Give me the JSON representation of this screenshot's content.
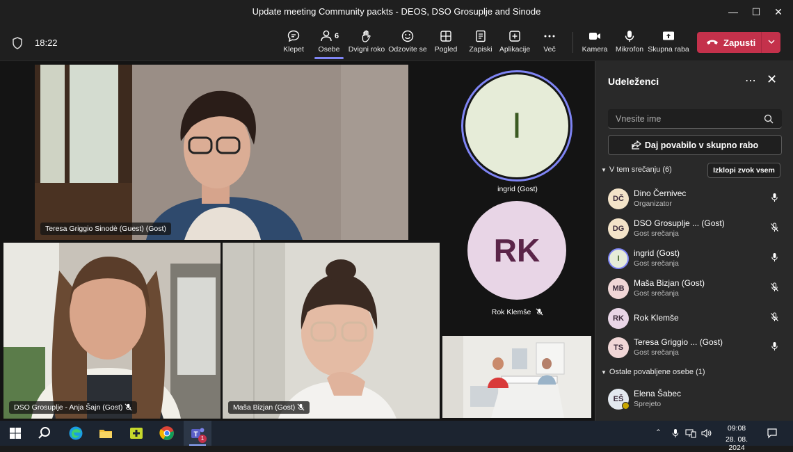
{
  "window": {
    "title": "Update meeting Community packts - DEOS, DSO Grosuplje and Sinode"
  },
  "toolbar": {
    "time": "18:22",
    "buttons": [
      {
        "id": "chat",
        "label": "Klepet"
      },
      {
        "id": "people",
        "label": "Osebe",
        "badge": "6"
      },
      {
        "id": "raise",
        "label": "Dvigni roko"
      },
      {
        "id": "react",
        "label": "Odzovite se"
      },
      {
        "id": "view",
        "label": "Pogled"
      },
      {
        "id": "notes",
        "label": "Zapiski"
      },
      {
        "id": "apps",
        "label": "Aplikacije"
      },
      {
        "id": "more",
        "label": "Več"
      },
      {
        "id": "camera",
        "label": "Kamera"
      },
      {
        "id": "mic",
        "label": "Mikrofon"
      },
      {
        "id": "share",
        "label": "Skupna raba"
      }
    ],
    "leave_label": "Zapusti"
  },
  "stage": {
    "tiles": [
      {
        "name": "Teresa Griggio Sinodè (Guest) (Gost)"
      },
      {
        "name": "DSO Grosuplje - Anja Šajn (Gost)"
      },
      {
        "name": "Maša Bizjan (Gost)"
      }
    ],
    "avatar_tiles": [
      {
        "initials": "I",
        "name": "ingrid (Gost)"
      },
      {
        "initials": "RK",
        "name": "Rok Klemše"
      }
    ]
  },
  "panel": {
    "title": "Udeleženci",
    "search_placeholder": "Vnesite ime",
    "share_invite_label": "Daj povabilo v skupno rabo",
    "in_meeting_label": "V tem srečanju (6)",
    "mute_all_label": "Izklopi zvok vsem",
    "participants": [
      {
        "initials": "DČ",
        "name": "Dino Černivec",
        "role": "Organizator",
        "mic": "on"
      },
      {
        "initials": "DG",
        "name": "DSO Grosuplje ... (Gost)",
        "role": "Gost srečanja",
        "mic": "off"
      },
      {
        "initials": "I",
        "name": "ingrid (Gost)",
        "role": "Gost srečanja",
        "mic": "on"
      },
      {
        "initials": "MB",
        "name": "Maša Bizjan (Gost)",
        "role": "Gost srečanja",
        "mic": "off"
      },
      {
        "initials": "RK",
        "name": "Rok Klemše",
        "role": "",
        "mic": "off"
      },
      {
        "initials": "TS",
        "name": "Teresa Griggio ... (Gost)",
        "role": "Gost srečanja",
        "mic": "on"
      }
    ],
    "others_label": "Ostale povabljene osebe (1)",
    "others": [
      {
        "initials": "EŠ",
        "name": "Elena Šabec",
        "role": "Sprejeto"
      }
    ]
  },
  "taskbar": {
    "time": "09:08",
    "date": "28. 08. 2024",
    "teams_badge": "1"
  },
  "colors": {
    "leave": "#c4314b",
    "accent": "#7f85f5",
    "avatar_bg": "#e8d5e6",
    "ingrid_bg": "#e6ecd8"
  }
}
